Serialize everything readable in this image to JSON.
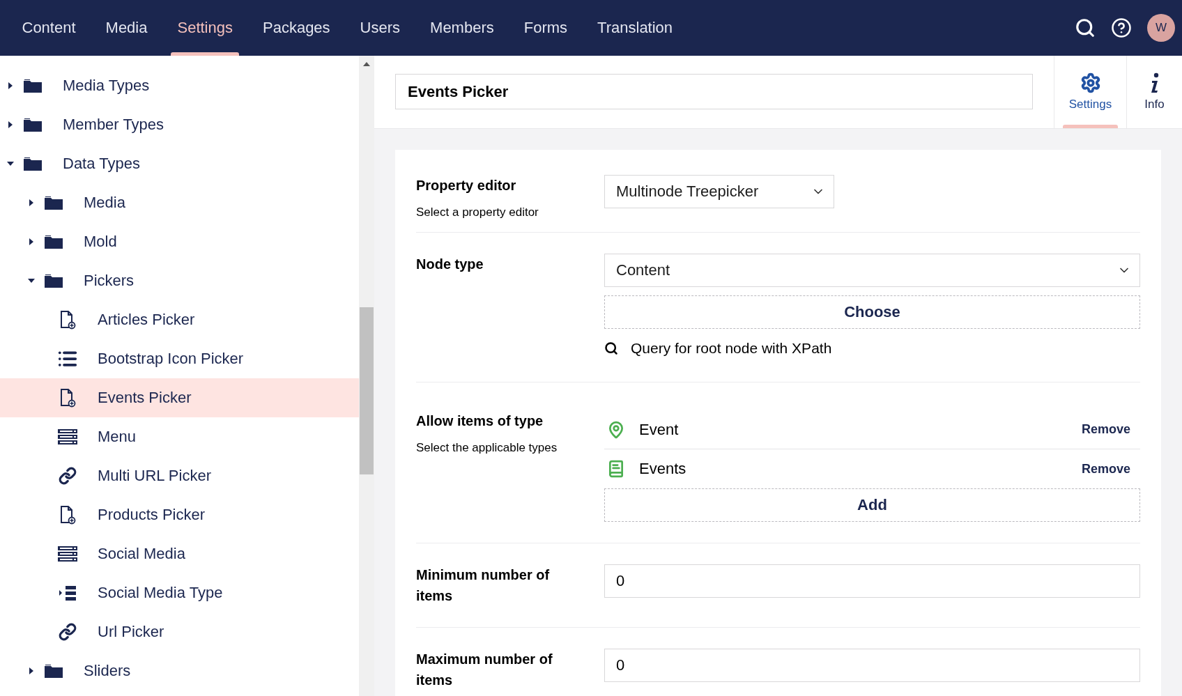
{
  "nav": {
    "sections": [
      {
        "label": "Content",
        "selected": false
      },
      {
        "label": "Media",
        "selected": false
      },
      {
        "label": "Settings",
        "selected": true
      },
      {
        "label": "Packages",
        "selected": false
      },
      {
        "label": "Users",
        "selected": false
      },
      {
        "label": "Members",
        "selected": false
      },
      {
        "label": "Forms",
        "selected": false
      },
      {
        "label": "Translation",
        "selected": false
      }
    ],
    "avatar": "W"
  },
  "tree": [
    {
      "label": "Media Types",
      "kind": "folder",
      "expanded": false,
      "selected": false
    },
    {
      "label": "Member Types",
      "kind": "folder",
      "expanded": false,
      "selected": false
    },
    {
      "label": "Data Types",
      "kind": "folder",
      "expanded": true,
      "selected": false,
      "children": [
        {
          "label": "Media",
          "kind": "folder",
          "expanded": false,
          "selected": false
        },
        {
          "label": "Mold",
          "kind": "folder",
          "expanded": false,
          "selected": false
        },
        {
          "label": "Pickers",
          "kind": "folder",
          "expanded": true,
          "selected": false,
          "children": [
            {
              "label": "Articles Picker",
              "kind": "document",
              "selected": false
            },
            {
              "label": "Bootstrap Icon Picker",
              "kind": "list",
              "selected": false
            },
            {
              "label": "Events Picker",
              "kind": "document",
              "selected": true
            },
            {
              "label": "Menu",
              "kind": "rows",
              "selected": false
            },
            {
              "label": "Multi URL Picker",
              "kind": "link",
              "selected": false
            },
            {
              "label": "Products Picker",
              "kind": "document",
              "selected": false
            },
            {
              "label": "Social Media",
              "kind": "rows",
              "selected": false
            },
            {
              "label": "Social Media Type",
              "kind": "indent-list",
              "selected": false
            },
            {
              "label": "Url Picker",
              "kind": "link",
              "selected": false
            }
          ]
        },
        {
          "label": "Sliders",
          "kind": "folder",
          "expanded": false,
          "selected": false
        }
      ]
    }
  ],
  "editor": {
    "name": "Events Picker",
    "apps": [
      {
        "label": "Settings",
        "kind": "gear",
        "selected": true
      },
      {
        "label": "Info",
        "kind": "info",
        "selected": false
      }
    ],
    "property_editor": {
      "label": "Property editor",
      "description": "Select a property editor",
      "value": "Multinode Treepicker"
    },
    "node_type": {
      "label": "Node type",
      "value": "Content",
      "choose": "Choose",
      "query": "Query for root node with XPath"
    },
    "allow": {
      "label": "Allow items of type",
      "description": "Select the applicable types",
      "items": [
        {
          "name": "Event",
          "kind": "pin",
          "remove": "Remove"
        },
        {
          "name": "Events",
          "kind": "book",
          "remove": "Remove"
        }
      ],
      "add": "Add"
    },
    "min": {
      "label": "Minimum number of items",
      "value": "0"
    },
    "max": {
      "label": "Maximum number of items",
      "value": "0"
    }
  }
}
